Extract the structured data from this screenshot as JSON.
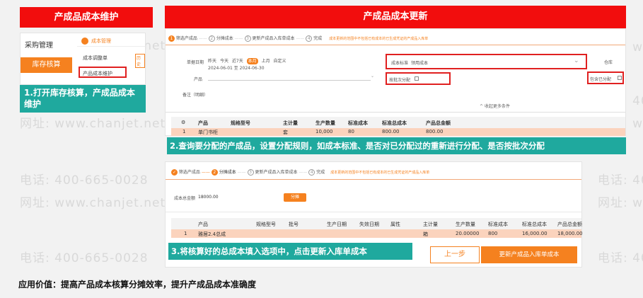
{
  "watermark": {
    "url": "网址: www.chanjet.net",
    "phone": "电话: 400-665-0028"
  },
  "left": {
    "title": "产成品成本维护",
    "menu_main": "采购管理",
    "menu_active": "库存核算",
    "sub_header": "成本管理",
    "sub_items": [
      "成本调整单",
      "产品成本维护"
    ],
    "sub_tag": "历史",
    "step1_caption": "1.打开库存核算，产成品成本维护"
  },
  "right": {
    "title": "产成品成本更新",
    "steps": [
      {
        "num": "1",
        "label": "筛选产成品"
      },
      {
        "num": "2",
        "label": "分摊成本"
      },
      {
        "num": "3",
        "label": "更新产成品入库单成本"
      },
      {
        "num": "4",
        "label": "完成"
      }
    ],
    "step_hint": "成本更新的范围中不包括已有成本的已生成凭证的产成品入库单",
    "form": {
      "date_label": "单据日期",
      "date_opts": [
        "昨天",
        "今天",
        "近7天",
        "本月",
        "上月",
        "自定义"
      ],
      "date_active": "本月",
      "date_range": "2024-06-01 至 2024-06-30",
      "product_label": "产品",
      "remark_label": "备注（明细）",
      "cost_std_label": "成本标准",
      "cost_std_value": "领用成本",
      "warehouse_label": "仓库",
      "batch_label": "按批次分配",
      "realloc_label": "包含已分配",
      "more_label": "收起更多条件"
    },
    "table1": {
      "headers": [
        "产品",
        "规格型号",
        "主计量",
        "生产数量",
        "标准成本",
        "标准总成本",
        "产品总金额"
      ],
      "row": [
        "1",
        "单门书柜",
        "",
        "套",
        "10,000",
        "80",
        "800.00",
        "800.00"
      ]
    },
    "step2_caption": "2.查询要分配的产成品，设置分配规则，如成本标准、是否对已分配过的重新进行分配、是否按批次分配",
    "panel2": {
      "total_label": "成本总金额",
      "total_value": "18000.00",
      "alloc_btn": "分摊"
    },
    "table2": {
      "headers": [
        "产品",
        "规格型号",
        "批号",
        "生产日期",
        "失效日期",
        "属性",
        "主计量",
        "生产数量",
        "标准成本",
        "标准总成本",
        "产品总金额"
      ],
      "row": [
        "1",
        "雅居2.4总成",
        "",
        "",
        "",
        "",
        "箱",
        "20.00000",
        "800",
        "16,000.00",
        "18,000.00"
      ]
    },
    "step3_caption": "3.将核算好的总成本填入选项中，点击更新入库单成本",
    "prev_btn": "上一步",
    "update_btn": "更新产成品入库单成本"
  },
  "footer": "应用价值：提高产品成本核算分摊效率，提升产成品成本准确度",
  "colors": {
    "red": "#f20d0d",
    "orange": "#f5811f",
    "teal": "#1fa99e",
    "row": "#fbd3bd"
  }
}
